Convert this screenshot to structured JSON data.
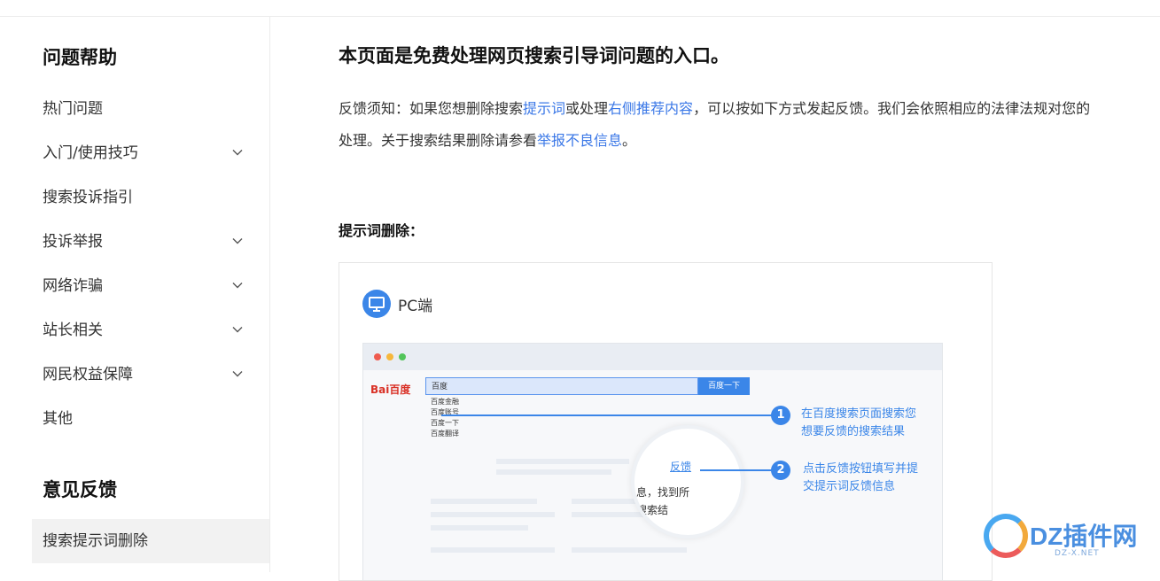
{
  "sidebar": {
    "help_title": "问题帮助",
    "items": [
      {
        "label": "热门问题",
        "expandable": false
      },
      {
        "label": "入门/使用技巧",
        "expandable": true
      },
      {
        "label": "搜索投诉指引",
        "expandable": false
      },
      {
        "label": "投诉举报",
        "expandable": true
      },
      {
        "label": "网络诈骗",
        "expandable": true
      },
      {
        "label": "站长相关",
        "expandable": true
      },
      {
        "label": "网民权益保障",
        "expandable": true
      },
      {
        "label": "其他",
        "expandable": false
      }
    ],
    "feedback_title": "意见反馈",
    "feedback_items": [
      {
        "label": "搜索提示词删除",
        "active": true
      }
    ]
  },
  "main": {
    "title": "本页面是免费处理网页搜索引导词问题的入口。",
    "notice_prefix": "反馈须知：如果您想删除搜索",
    "notice_link1": "提示词",
    "notice_mid1": "或处理",
    "notice_link2": "右侧推荐内容",
    "notice_mid2": "，可以按如下方式发起反馈。我们会依照相应的法律法规对您的",
    "notice_line2": "处理。关于搜索结果删除请参看",
    "notice_link3": "举报不良信息",
    "notice_end": "。",
    "section_title": "提示词删除：",
    "card": {
      "platform_label": "PC端",
      "logo_text": "Bai百度",
      "search_value": "百度",
      "search_button": "百度一下",
      "suggestions": [
        "百度金融",
        "百度账号",
        "百度一下",
        "百度翻译"
      ],
      "feedback_link": "反馈",
      "magnifier_text": "息，找到所\n搜索结",
      "steps": [
        {
          "number": "1",
          "text": "在百度搜索页面搜索您\n想要反馈的搜索结果"
        },
        {
          "number": "2",
          "text": "点击反馈按钮填写并提\n交提示词反馈信息"
        }
      ]
    }
  },
  "watermark": {
    "text": "DZ插件网",
    "sub": "DZ-X.NET"
  },
  "colors": {
    "accent": "#3b86e8",
    "link": "#3b78e7",
    "active_bg": "#f2f2f2"
  }
}
